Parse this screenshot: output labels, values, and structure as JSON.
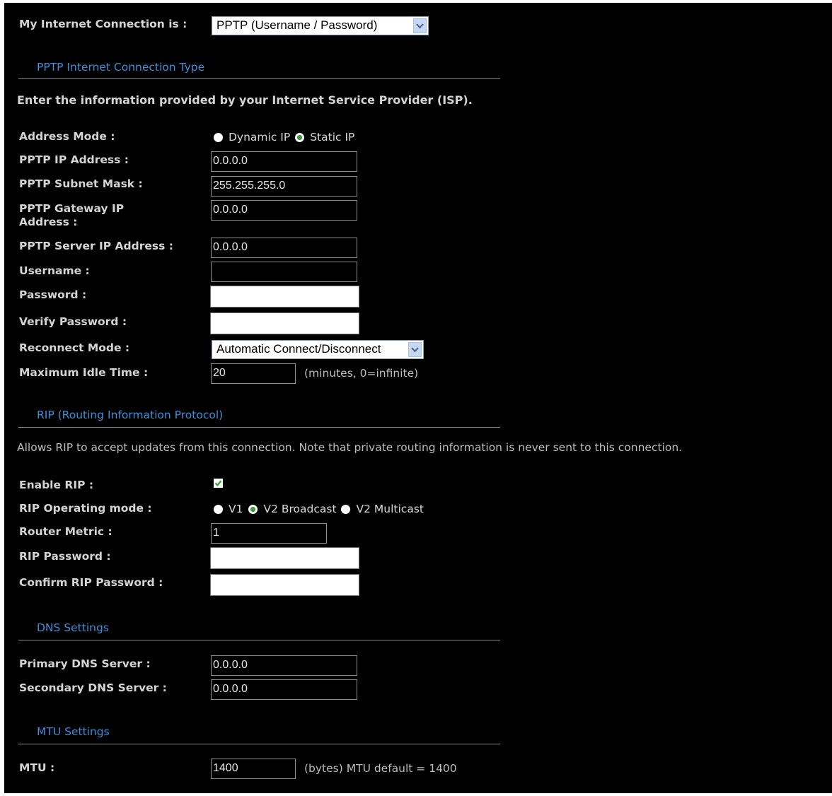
{
  "connection": {
    "label": "My Internet Connection is :",
    "selected": "PPTP (Username / Password)"
  },
  "pptp": {
    "section_title": "PPTP Internet Connection Type",
    "intro": "Enter the information provided by your Internet Service Provider (ISP).",
    "address_mode_label": "Address Mode :",
    "address_mode_options": [
      "Dynamic IP",
      "Static IP"
    ],
    "address_mode_selected": "Static IP",
    "ip_label": "PPTP IP Address :",
    "ip_value": "0.0.0.0",
    "subnet_label": "PPTP Subnet Mask :",
    "subnet_value": "255.255.255.0",
    "gateway_label": "PPTP Gateway IP Address :",
    "gateway_value": "0.0.0.0",
    "server_label": "PPTP Server IP Address :",
    "server_value": "0.0.0.0",
    "username_label": "Username :",
    "username_value": "",
    "password_label": "Password :",
    "password_value": "",
    "verify_label": "Verify Password :",
    "verify_value": "",
    "reconnect_label": "Reconnect Mode :",
    "reconnect_selected": "Automatic Connect/Disconnect",
    "idle_label": "Maximum Idle Time :",
    "idle_value": "20",
    "idle_hint": "(minutes, 0=infinite)"
  },
  "rip": {
    "section_title": "RIP (Routing Information Protocol)",
    "intro": "Allows RIP to accept updates from this connection. Note that private routing information is never sent to this connection.",
    "enable_label": "Enable RIP :",
    "enable_checked": true,
    "mode_label": "RIP Operating mode :",
    "mode_options": [
      "V1",
      "V2 Broadcast",
      "V2 Multicast"
    ],
    "mode_selected": "V2 Broadcast",
    "metric_label": "Router Metric :",
    "metric_value": "1",
    "password_label": "RIP Password :",
    "password_value": "",
    "confirm_label": "Confirm RIP Password :",
    "confirm_value": ""
  },
  "dns": {
    "section_title": "DNS Settings",
    "primary_label": "Primary DNS Server :",
    "primary_value": "0.0.0.0",
    "secondary_label": "Secondary DNS Server :",
    "secondary_value": "0.0.0.0"
  },
  "mtu": {
    "section_title": "MTU Settings",
    "label": "MTU :",
    "value": "1400",
    "hint": "(bytes) MTU default = 1400"
  },
  "colors": {
    "background": "#000000",
    "section_title": "#3d8fd8",
    "label": "#d4d4d4",
    "radio_selected": "#3fa33f",
    "checkbox_check": "#3fa33f"
  },
  "icons": {
    "select_arrow": "chevron-down-icon",
    "checkbox_mark": "checkmark-icon"
  }
}
